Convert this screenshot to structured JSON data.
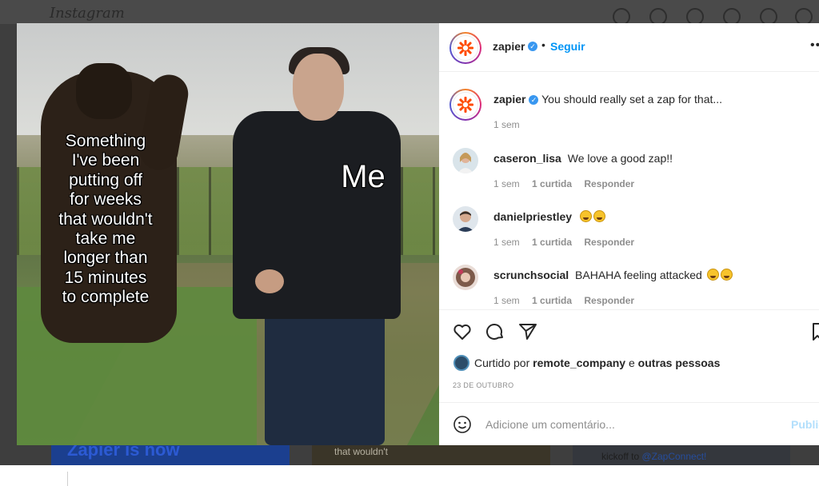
{
  "backdrop": {
    "logo": "Instagram",
    "bg_card_left": "Zapier is now",
    "bg_card_mid": "that wouldn't",
    "bg_card_right_prefix": "kickoff to ",
    "bg_card_right_link": "@ZapConnect!"
  },
  "meme": {
    "left_caption": "Something\nI've been\nputting off\nfor weeks\nthat wouldn't\ntake me\nlonger than\n15 minutes\nto complete",
    "right_caption": "Me"
  },
  "header": {
    "username": "zapier",
    "separator": "•",
    "follow_label": "Seguir",
    "more_label": "•••"
  },
  "caption": {
    "username": "zapier",
    "text": "You should really set a zap for that...",
    "time": "1 sem"
  },
  "comments": [
    {
      "username": "caseron_lisa",
      "text": "We love a good zap!!",
      "time": "1 sem",
      "likes": "1 curtida",
      "reply": "Responder",
      "emoji_count": 0
    },
    {
      "username": "danielpriestley",
      "text": "",
      "time": "1 sem",
      "likes": "1 curtida",
      "reply": "Responder",
      "emoji_count": 2
    },
    {
      "username": "scrunchsocial",
      "text": "BAHAHA feeling attacked",
      "time": "1 sem",
      "likes": "1 curtida",
      "reply": "Responder",
      "emoji_count": 2
    }
  ],
  "likes": {
    "prefix": "Curtido por",
    "user": "remote_company",
    "middle": "e",
    "suffix": "outras pessoas"
  },
  "date": "23 DE OUTUBRO",
  "add_comment": {
    "placeholder": "Adicione um comentário...",
    "publish_label": "Publicar"
  },
  "colors": {
    "accent": "#0095f6",
    "publish_disabled": "#b2dffc",
    "zapier_orange": "#ff4a00"
  },
  "icons": [
    "heart-icon",
    "comment-icon",
    "share-icon",
    "bookmark-icon",
    "smile-icon",
    "verified-icon",
    "zapier-logo-icon"
  ]
}
